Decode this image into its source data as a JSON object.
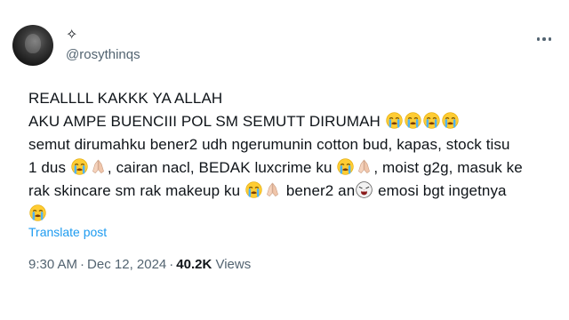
{
  "author": {
    "display_name": "✧",
    "handle": "@rosythinqs"
  },
  "menu": {
    "icon": "more-horizontal-icon"
  },
  "post": {
    "line1": "REALLLL KAKKK YA ALLAH",
    "line2_text": "AKU AMPE BUENCIII POL SM SEMUTT DIRUMAH",
    "line3": "semut dirumahku bener2 udh ngerumunin cotton bud, kapas, stock tisu",
    "line4a": "1 dus",
    "line4b": ", cairan nacl, BEDAK luxcrime ku",
    "line4c": ", moist g2g, masuk ke",
    "line5a": "rak skincare sm rak makeup ku",
    "line5b": "bener2 an",
    "line5c": "emosi bgt ingetnya",
    "emoji_names": [
      "loudly-crying-face-icon",
      "folded-hands-icon",
      "weary-face-icon"
    ]
  },
  "translate_label": "Translate post",
  "meta": {
    "time": "9:30 AM",
    "separator": "·",
    "date": "Dec 12, 2024",
    "views_count": "40.2K",
    "views_label": "Views"
  }
}
